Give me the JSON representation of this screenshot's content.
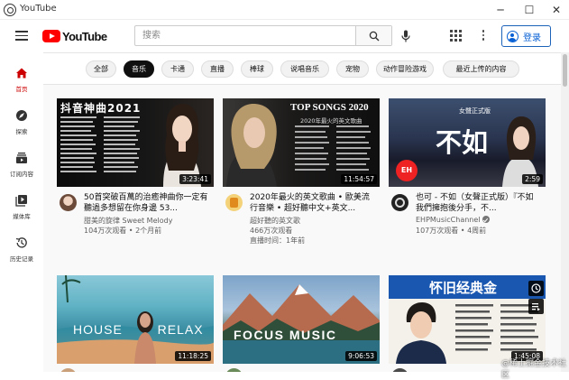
{
  "window": {
    "title": "YouTube",
    "controls": [
      "─",
      "☐",
      "✕"
    ]
  },
  "header": {
    "brand": "YouTube",
    "search_placeholder": "搜索",
    "signin_label": "登录"
  },
  "nav": [
    {
      "label": "首页",
      "icon": "home-icon",
      "active": true
    },
    {
      "label": "探索",
      "icon": "compass-icon",
      "active": false
    },
    {
      "label": "订阅内容",
      "icon": "subscriptions-icon",
      "active": false
    },
    {
      "label": "媒体库",
      "icon": "library-icon",
      "active": false
    },
    {
      "label": "历史记录",
      "icon": "history-icon",
      "active": false
    }
  ],
  "chips": [
    {
      "label": "全部",
      "active": false
    },
    {
      "label": "音乐",
      "active": true
    },
    {
      "label": "卡通",
      "active": false
    },
    {
      "label": "直播",
      "active": false
    },
    {
      "label": "棒球",
      "active": false
    },
    {
      "label": "说唱音乐",
      "active": false
    },
    {
      "label": "宠物",
      "active": false
    },
    {
      "label": "动作冒险游戏",
      "active": false
    },
    {
      "label": "最近上传的内容",
      "active": false
    }
  ],
  "videos": [
    {
      "thumb_text": "抖音神曲2021",
      "duration": "3:23:41",
      "title": "50首突破百萬的治癒神曲你一定有聽過多想留在你身邊 53...",
      "channel": "甜美的旋律 Sweet Melody",
      "meta": "104万次观看 • 2个月前"
    },
    {
      "thumb_text": "TOP SONGS 2020",
      "thumb_sub": "2020年最火的英文歌曲",
      "duration": "11:54:57",
      "title": "2020年最火的英文歌曲 • 歐美流行音樂 • 超好聽中文+英文...",
      "channel": "超好聽的英文歌",
      "meta": "466万次观看",
      "meta2": "直播时间：1年前"
    },
    {
      "thumb_text": "不如",
      "thumb_sub": "女聲正式版",
      "duration": "2:59",
      "title": "也可 - 不如（女聲正式版）『不如我們擁抱後分手，不...",
      "channel": "EHPMusicChannel",
      "meta": "107万次观看 • 4周前"
    },
    {
      "thumb_text": "HOUSE RELAX",
      "duration": "11:18:25"
    },
    {
      "thumb_text": "FOCUS MUSIC",
      "duration": "9:06:53"
    },
    {
      "thumb_text": "怀旧经典金",
      "duration": "1:45:08"
    }
  ],
  "watermark": "@稀土掘金技术社区",
  "colors": {
    "brand_red": "#ff0000",
    "active_nav": "#cc0000",
    "link_blue": "#065fd4"
  }
}
